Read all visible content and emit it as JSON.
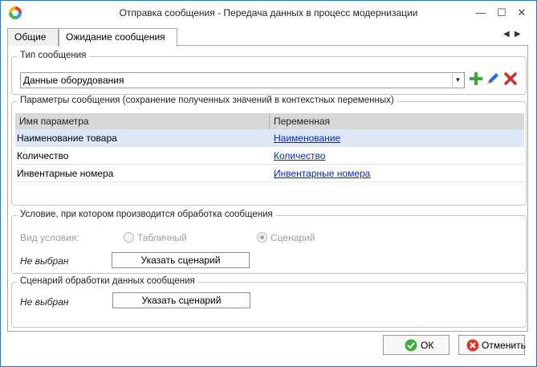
{
  "window": {
    "title": "Отправка сообщения - Передача данных в процесс модернизации",
    "controls": {
      "minimize": "—",
      "maximize": "☐",
      "close": "✕"
    }
  },
  "tabs": [
    {
      "label": "Общие",
      "active": false
    },
    {
      "label": "Ожидание сообщения",
      "active": true
    }
  ],
  "tab_nav": {
    "prev": "◀",
    "next": "▶"
  },
  "message_type": {
    "legend": "Тип сообщения",
    "selected": "Данные оборудования",
    "add_icon": "plus-icon",
    "edit_icon": "pencil-icon",
    "delete_icon": "x-icon",
    "colors": {
      "add": "#3da53a",
      "edit": "#2b6fd6",
      "delete": "#d42a2a"
    }
  },
  "params": {
    "legend": "Параметры сообщения (сохранение полученных значений в контекстных переменных)",
    "columns": [
      "Имя параметра",
      "Переменная"
    ],
    "rows": [
      {
        "name": "Наименование товара",
        "variable": "Наименование",
        "selected": true
      },
      {
        "name": "Количество",
        "variable": "Количество",
        "selected": false
      },
      {
        "name": "Инвентарные номера",
        "variable": "Инвентарные номера",
        "selected": false
      }
    ]
  },
  "condition": {
    "legend": "Условие, при котором производится обработка сообщения",
    "type_label": "Вид условия:",
    "option_table": "Табличный",
    "option_script": "Сценарий",
    "selected_option": "Сценарий",
    "status": "Не выбран",
    "button": "Указать сценарий"
  },
  "handler": {
    "legend": "Сценарий обработки данных сообщения",
    "status": "Не выбран",
    "button": "Указать сценарий"
  },
  "footer": {
    "ok": "ОК",
    "cancel": "Отменить",
    "ok_icon": "check-circle-icon",
    "cancel_icon": "cancel-circle-icon",
    "colors": {
      "ok": "#3fae3a",
      "cancel": "#d9392c"
    }
  }
}
